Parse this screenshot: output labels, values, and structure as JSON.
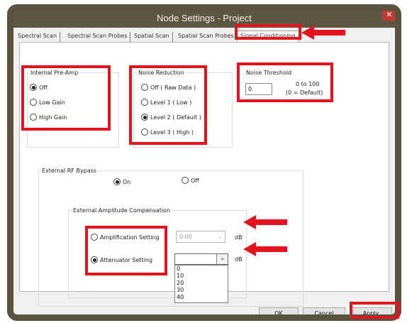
{
  "window": {
    "title": "Node Settings - Project",
    "close_label": "✕"
  },
  "tabs": [
    {
      "label": "Spectral Scan"
    },
    {
      "label": "Spectral Scan Probes"
    },
    {
      "label": "Spatial Scan"
    },
    {
      "label": "Spatial Scan Probes"
    },
    {
      "label": "Signal Conditioning",
      "active": true
    }
  ],
  "preamp": {
    "title": "Internal  Pre-Amp",
    "options": [
      {
        "label": "Off",
        "selected": true
      },
      {
        "label": "Low Gain",
        "selected": false
      },
      {
        "label": "High Gain",
        "selected": false
      }
    ]
  },
  "noise_reduction": {
    "title": "Noise Reduction",
    "options": [
      {
        "label": "Off ( Raw Data )",
        "selected": false
      },
      {
        "label": "Level 1 ( Low )",
        "selected": false
      },
      {
        "label": "Level 2 ( Default )",
        "selected": true
      },
      {
        "label": "Level 3 ( High )",
        "selected": false
      }
    ]
  },
  "noise_threshold": {
    "title": "Noise Threshold",
    "value": "0",
    "range": "0 to 100",
    "default_note": "(0 = Default)"
  },
  "rf_bypass": {
    "title": "External RF Bypass",
    "on_label": "On",
    "off_label": "Off",
    "selected": "On"
  },
  "amp_comp": {
    "title": "External Amplitude Compensation",
    "amplification": {
      "label": "Amplification Setting",
      "value": "0.00",
      "unit": "dB",
      "selected": false
    },
    "attenuator": {
      "label": "Attenuator Setting",
      "value": "",
      "unit": "dB",
      "selected": true,
      "options": [
        "0",
        "10",
        "20",
        "30",
        "40"
      ]
    }
  },
  "buttons": {
    "ok": "OK",
    "cancel": "Cancel",
    "apply": "Apply"
  },
  "colors": {
    "highlight": "#e3141d",
    "frame": "#5a533f"
  }
}
